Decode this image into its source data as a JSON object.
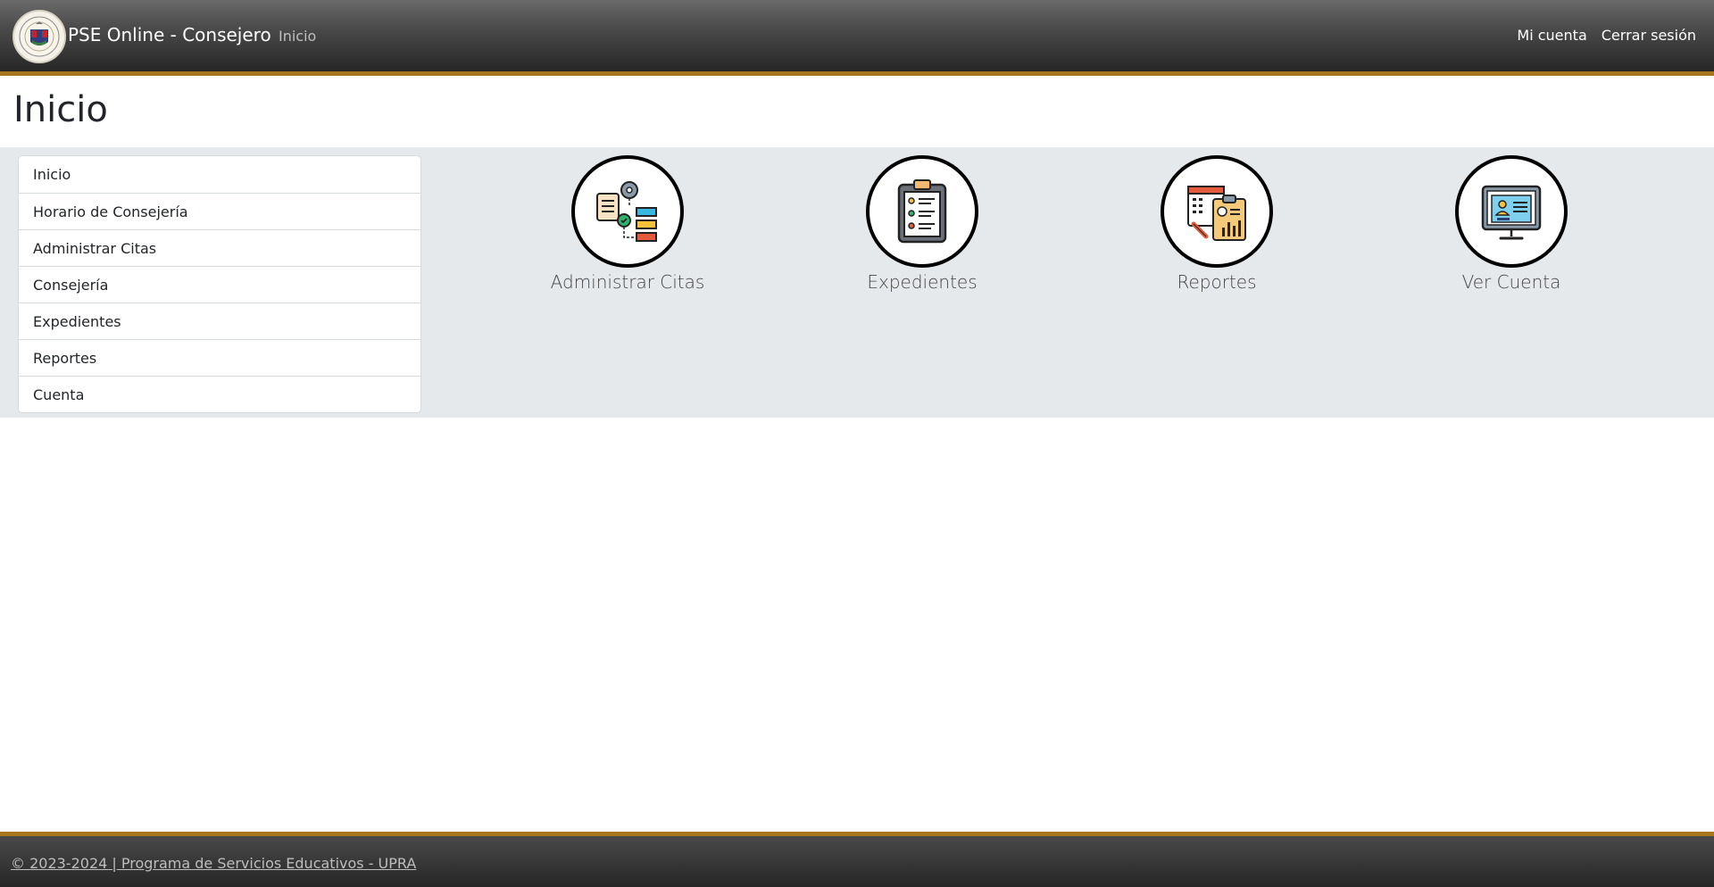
{
  "navbar": {
    "brand": "PSE Online - Consejero",
    "home_link": "Inicio",
    "my_account": "Mi cuenta",
    "logout": "Cerrar sesión"
  },
  "page": {
    "title": "Inicio"
  },
  "sidebar": {
    "items": [
      {
        "label": "Inicio"
      },
      {
        "label": "Horario de Consejería"
      },
      {
        "label": "Administrar Citas"
      },
      {
        "label": "Consejería"
      },
      {
        "label": "Expedientes"
      },
      {
        "label": "Reportes"
      },
      {
        "label": "Cuenta"
      }
    ]
  },
  "tiles": [
    {
      "label": "Administrar Citas",
      "icon": "workflow-gear-icon"
    },
    {
      "label": "Expedientes",
      "icon": "clipboard-records-icon"
    },
    {
      "label": "Reportes",
      "icon": "report-chart-icon"
    },
    {
      "label": "Ver Cuenta",
      "icon": "monitor-profile-icon"
    }
  ],
  "footer": {
    "text": "© 2023-2024 | Programa de Servicios Educativos - UPRA"
  },
  "colors": {
    "accent_gold": "#a8761c",
    "nav_dark": "#262626",
    "band_gray": "#e6e9ec"
  }
}
